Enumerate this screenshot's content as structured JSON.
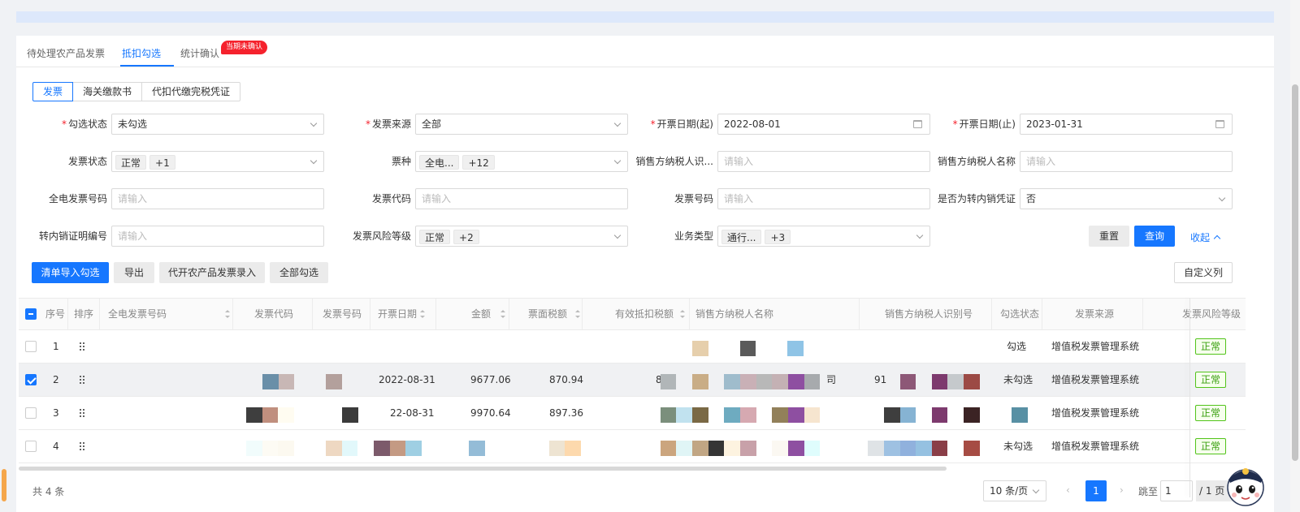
{
  "tabs": [
    {
      "label": "待处理农产品发票",
      "active": false
    },
    {
      "label": "抵扣勾选",
      "active": true
    },
    {
      "label": "统计确认",
      "active": false
    }
  ],
  "tab_badge": "当期未确认",
  "segments": [
    "发票",
    "海关缴款书",
    "代扣代缴完税凭证"
  ],
  "form": {
    "check_status": {
      "label": "勾选状态",
      "value": "未勾选"
    },
    "invoice_source": {
      "label": "发票来源",
      "value": "全部"
    },
    "date_start": {
      "label": "开票日期(起)",
      "value": "2022-08-01"
    },
    "date_end": {
      "label": "开票日期(止)",
      "value": "2023-01-31"
    },
    "invoice_status": {
      "label": "发票状态",
      "tag1": "正常",
      "tag2": "+1"
    },
    "ticket_type": {
      "label": "票种",
      "tag1": "全电...",
      "tag2": "+12"
    },
    "seller_tax_id": {
      "label": "销售方纳税人识...",
      "placeholder": "请输入"
    },
    "seller_name": {
      "label": "销售方纳税人名称",
      "placeholder": "请输入"
    },
    "full_invoice_no": {
      "label": "全电发票号码",
      "placeholder": "请输入"
    },
    "invoice_code": {
      "label": "发票代码",
      "placeholder": "请输入"
    },
    "invoice_no": {
      "label": "发票号码",
      "placeholder": "请输入"
    },
    "is_transfer": {
      "label": "是否为转内销凭证",
      "value": "否"
    },
    "transfer_no": {
      "label": "转内销证明编号",
      "placeholder": "请输入"
    },
    "risk_level": {
      "label": "发票风险等级",
      "tag1": "正常",
      "tag2": "+2"
    },
    "biz_type": {
      "label": "业务类型",
      "tag1": "通行...",
      "tag2": "+3"
    },
    "required_mark": "*"
  },
  "buttons": {
    "reset": "重置",
    "query": "查询",
    "collapse": "收起",
    "import_check": "清单导入勾选",
    "export": "导出",
    "agri_entry": "代开农产品发票录入",
    "check_all": "全部勾选",
    "custom_columns": "自定义列"
  },
  "table": {
    "columns": [
      "序号",
      "排序",
      "全电发票号码",
      "发票代码",
      "发票号码",
      "开票日期",
      "金额",
      "票面税额",
      "有效抵扣税额",
      "销售方纳税人名称",
      "销售方纳税人识别号",
      "勾选状态",
      "发票来源",
      "发票风险等级"
    ],
    "rows": [
      {
        "no": "1",
        "date": "",
        "amount": "",
        "tax": "",
        "valid_tax": "",
        "seller_name": "",
        "seller_id": "",
        "status": "勾选",
        "source": "增值税发票管理系统",
        "risk": "正常",
        "selected": false
      },
      {
        "no": "2",
        "date": "2022-08-31",
        "amount": "9677.06",
        "tax": "870.94",
        "valid_tax": "8",
        "seller_name": "司",
        "seller_id": "91",
        "status": "未勾选",
        "source": "增值税发票管理系统",
        "risk": "正常",
        "selected": true
      },
      {
        "no": "3",
        "date": "22-08-31",
        "amount": "9970.64",
        "tax": "897.36",
        "valid_tax": "",
        "seller_name": "",
        "seller_id": "",
        "status": "",
        "source": "增值税发票管理系统",
        "risk": "正常",
        "selected": false
      },
      {
        "no": "4",
        "date": "",
        "amount": "",
        "tax": "",
        "valid_tax": "",
        "seller_name": "",
        "seller_id": "",
        "status": "未勾选",
        "source": "增值税发票管理系统",
        "risk": "正常",
        "selected": false
      }
    ]
  },
  "pagination": {
    "total": "共 4 条",
    "page_size": "10 条/页",
    "current_page": "1",
    "jump_label": "跳至",
    "jump_value": "1",
    "page_of": "/ 1 页",
    "prev": "‹",
    "next": "›"
  },
  "colors": {
    "primary": "#1677ff",
    "danger": "#f5222d",
    "success": "#389e0d"
  }
}
